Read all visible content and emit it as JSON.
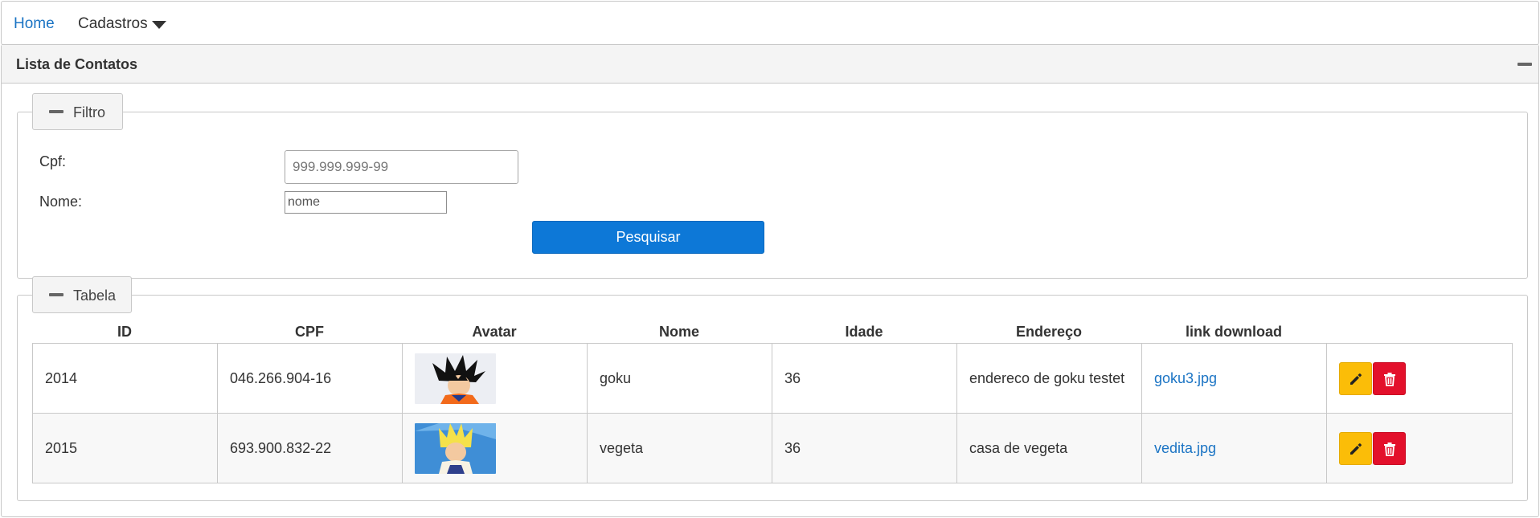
{
  "nav": {
    "home": "Home",
    "cadastros": "Cadastros"
  },
  "panel": {
    "title": "Lista de Contatos"
  },
  "filter": {
    "legend": "Filtro",
    "cpf_label": "Cpf:",
    "cpf_placeholder": "999.999.999-99",
    "nome_label": "Nome:",
    "nome_placeholder": "nome",
    "search_button": "Pesquisar"
  },
  "table": {
    "legend": "Tabela",
    "headers": [
      "ID",
      "CPF",
      "Avatar",
      "Nome",
      "Idade",
      "Endereço",
      "link download"
    ],
    "rows": [
      {
        "id": "2014",
        "cpf": "046.266.904-16",
        "avatar": "goku-avatar",
        "nome": "goku",
        "idade": "36",
        "endereco": "endereco de goku testet",
        "link": "goku3.jpg"
      },
      {
        "id": "2015",
        "cpf": "693.900.832-22",
        "avatar": "vegeta-avatar",
        "nome": "vegeta",
        "idade": "36",
        "endereco": "casa de vegeta",
        "link": "vedita.jpg"
      }
    ],
    "actions": {
      "edit_icon": "pencil-icon",
      "delete_icon": "trash-icon"
    }
  },
  "colors": {
    "link": "#1b74c4",
    "primary_button": "#0d78d7",
    "edit_button": "#fbbd08",
    "delete_button": "#e3102b"
  }
}
